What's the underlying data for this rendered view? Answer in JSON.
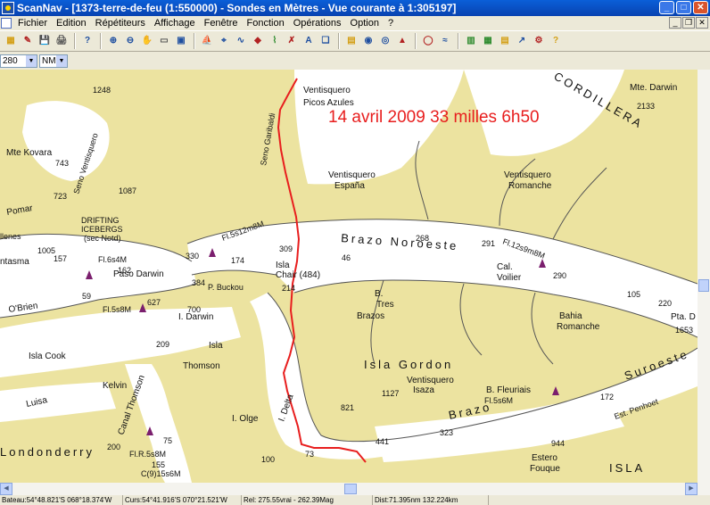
{
  "window": {
    "title": "ScanNav - [1373-terre-de-feu (1:550000) - Sondes en  Mètres  - Vue courante à 1:305197]",
    "controls": {
      "minimize": "_",
      "maximize": "□",
      "close": "✕"
    }
  },
  "menu": {
    "items": [
      "Fichier",
      "Edition",
      "Répétiteurs",
      "Affichage",
      "Fenêtre",
      "Fonction",
      "Opérations",
      "Option",
      "?"
    ],
    "mdi_controls": {
      "minimize": "_",
      "restore": "❐",
      "close": "✕"
    }
  },
  "toolbar": {
    "icons": [
      "new-chart-icon",
      "open-icon",
      "save-icon",
      "print-icon",
      "help-pointer-icon",
      "zoom-in-icon",
      "zoom-out-icon",
      "pan-hand-icon",
      "rectangle-icon",
      "window-icon",
      "boat-icon",
      "crosshair-icon",
      "route-icon",
      "waypoint-icon",
      "track-icon",
      "mark-icon",
      "text-icon",
      "layers-icon",
      "nmea-icon",
      "gps-icon",
      "compass-icon",
      "alarm-icon",
      "lifebuoy-icon",
      "tide-icon",
      "grid-icon",
      "chart-icon",
      "graph-icon",
      "wind-icon",
      "settings-icon",
      "about-icon"
    ],
    "glyphs": [
      "▦",
      "✎",
      "💾",
      "🖨",
      "?",
      "⊕",
      "⊖",
      "✋",
      "▭",
      "▣",
      "⛵",
      "⌖",
      "∿",
      "◆",
      "⌇",
      "✗",
      "A",
      "❏",
      "▤",
      "◉",
      "◎",
      "▲",
      "◯",
      "≈",
      "▥",
      "▦",
      "▤",
      "↗",
      "⚙",
      "?"
    ],
    "colors": [
      "#d4a017",
      "#b22222",
      "#1f4fa0",
      "#555555",
      "#1f4fa0",
      "#1f4fa0",
      "#1f4fa0",
      "#555555",
      "#555555",
      "#1f4fa0",
      "#b22222",
      "#1f4fa0",
      "#1f4fa0",
      "#b22222",
      "#2e8b2e",
      "#b22222",
      "#1f4fa0",
      "#1f4fa0",
      "#d4a017",
      "#1f4fa0",
      "#1f4fa0",
      "#b22222",
      "#b22222",
      "#1f4fa0",
      "#2e8b2e",
      "#2e8b2e",
      "#d4a017",
      "#1f4fa0",
      "#b22222",
      "#d4a017"
    ]
  },
  "subbar": {
    "scale_value": "280",
    "unit_value": "NM"
  },
  "map": {
    "annotation": "14 avril 2009 33 milles 6h50",
    "annotation_color": "#e81e1e",
    "track_color": "#e81e1e",
    "land_color": "#ece3a0",
    "water_color": "#ffffff",
    "places": {
      "picos_azules": "Picos Azules",
      "ventisquero_1": "Ventisquero",
      "ventisquero_espana": "Ventisquero",
      "espana": "España",
      "ventisquero_romanche": "Ventisquero",
      "romanche": "Romanche",
      "mte_kovara": "Mte Kovara",
      "mte_darwin": "Mte. Darwin",
      "darwin_h": "2133",
      "cordillera": "CORDILLERA",
      "brazo_noroeste": "Brazo Noroeste",
      "paso_darwin": "Paso Darwin",
      "isla_chair": "Isla",
      "chair": "Chair (484)",
      "cal_voilier": "Cal.",
      "voilier": "Voilier",
      "tres_brazos_b": "B.",
      "tres": "Tres",
      "brazos": "Brazos",
      "i_darwin": "I. Darwin",
      "isla": "Isla",
      "thomson": "Thomson",
      "isla_cook": "Isla Cook",
      "obrien": "O'Brien",
      "kelvin": "Kelvin",
      "isla_gordon": "Isla  Gordon",
      "ventisquero_isaza": "Ventisquero",
      "isaza": "Isaza",
      "bahia": "Bahia",
      "bahia_romanche": "Romanche",
      "b_fleuriais": "B. Fleuriais",
      "suroeste": "Suroeste",
      "brazo_s": "Brazo",
      "i_delta": "I. Delta",
      "i_olge": "I. Olge",
      "londonderry": "Londonderry",
      "estero_fouque": "Estero",
      "fouque": "Fouque",
      "isla_bottom": "ISLA",
      "canal_thomson": "Canal Thomson",
      "p_buckou": "P. Buckou",
      "drifting": "DRIFTING",
      "icebergs": "ICEBERGS",
      "sec_notd": "(sec Notd)",
      "pta_d": "Pta. D",
      "seno_ventisquero": "Seno Ventisquero",
      "seno_garibaldi": "Seno Garibaldi",
      "pomar": "Pomar",
      "tantasma": "ntasma",
      "allenes": "llenes",
      "isla_luisa": "Luisa",
      "est_penhoet": "Est. Penhoet"
    },
    "depths": [
      "1248",
      "743",
      "723",
      "1087",
      "1005",
      "330",
      "174",
      "309",
      "268",
      "291",
      "46",
      "384",
      "290",
      "220",
      "214",
      "627",
      "700",
      "209",
      "105",
      "1653",
      "1127",
      "821",
      "441",
      "323",
      "172",
      "944",
      "155",
      "100",
      "73",
      "75",
      "200",
      "162",
      "157",
      "59"
    ],
    "lights": [
      "Fl.5s12m8M",
      "Fl.6s4M",
      "Fl.5s8M",
      "Fl.12s9m8M",
      "Fl.5s6M",
      "Fl.R.5s8M",
      "C(9)15s6M",
      "Fl.5s8M"
    ]
  },
  "status": {
    "bateau": "Bateau:54°48.821'S 068°18.374'W",
    "curseur": "Curs:54°41.916'S 070°21.521'W",
    "relevement": "Rel: 275.55vrai - 262.39Mag",
    "distance": "Dist:71.395nm  132.224km"
  }
}
